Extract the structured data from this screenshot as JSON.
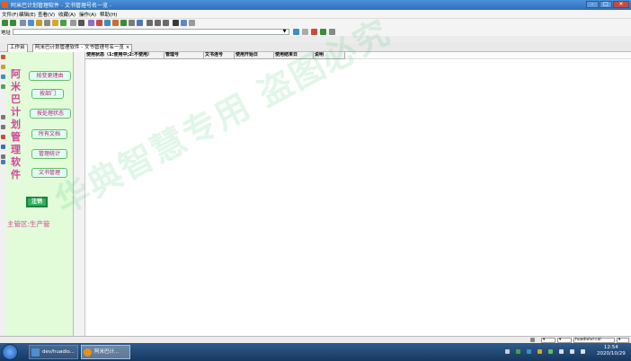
{
  "window": {
    "title": "阿米巴计划管理软件 - 文书管理号名一览 -"
  },
  "menubar": [
    "文件(F)",
    "编辑(E)",
    "查看(V)",
    "收藏(A)",
    "操作(A)",
    "帮助(H)"
  ],
  "address": {
    "label": "地址",
    "value": ""
  },
  "tabs": [
    {
      "label": "工作台"
    },
    {
      "label": "阿米巴计划管理软件 - 文书管理号名一览 ×"
    }
  ],
  "sidebar": {
    "title_chars": [
      "阿",
      "米",
      "巴",
      "计",
      "划",
      "管",
      "理",
      "软",
      "件"
    ],
    "buttons": [
      "按变更理由",
      "按部门",
      "按处理状态",
      "所有文档",
      "管理统计",
      "文书管理"
    ],
    "logout_label": "注销",
    "district": "主管区:生产管"
  },
  "grid": {
    "columns": [
      "使用状态（1:使用中;2:不使用）",
      "管理号",
      "文书连号",
      "使用开始日",
      "使用结束日",
      "说明"
    ]
  },
  "watermark": "华典智慧专用 盗图必究",
  "statusbar": {
    "user_select": "huadio\\vl cal"
  },
  "taskbar": {
    "tasks": [
      "dev/huadio...",
      "阿米巴计..."
    ],
    "clock_time": "12:54",
    "clock_date": "2020/10/29"
  },
  "colors": {
    "panel_bg": "#e2fbd9",
    "accent_pink": "#d2479c",
    "logout_green": "#2db35e"
  }
}
